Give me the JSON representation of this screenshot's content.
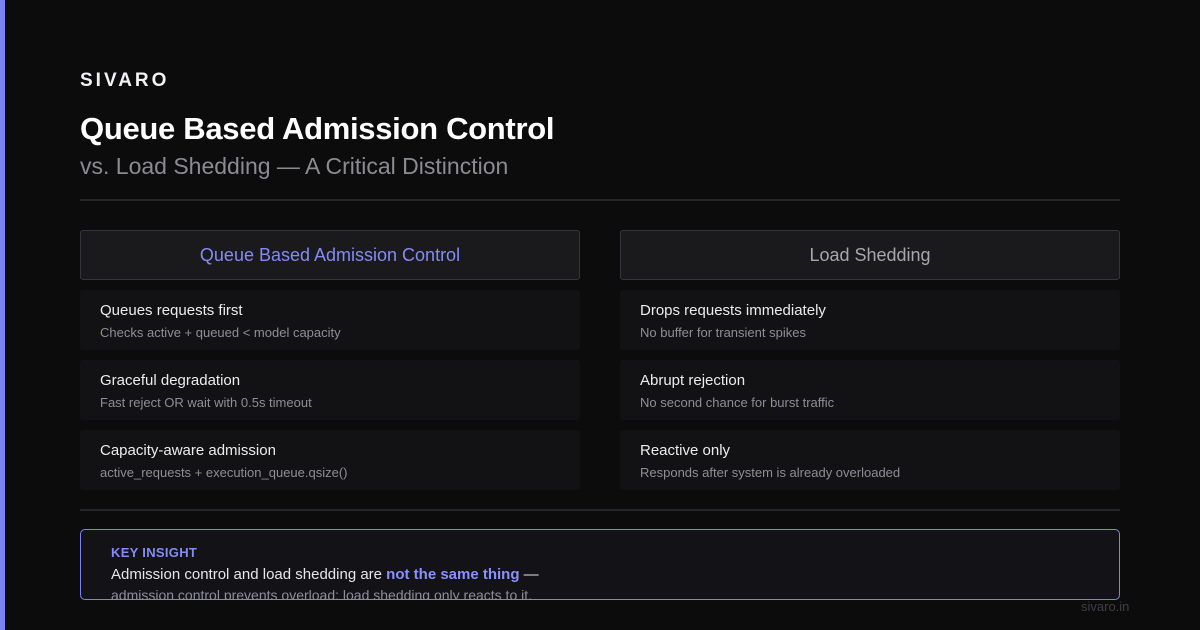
{
  "brand": "SIVARO",
  "title": "Queue Based Admission Control",
  "subtitle": "vs. Load Shedding — A Critical Distinction",
  "colors": {
    "accent": "#7c82f2",
    "background": "#0c0c0d",
    "highlight": "#8a90ff"
  },
  "left_column": {
    "header": "Queue Based Admission Control",
    "cards": [
      {
        "title": "Queues requests first",
        "desc": "Checks active + queued < model capacity"
      },
      {
        "title": "Graceful degradation",
        "desc": "Fast reject OR wait with 0.5s timeout"
      },
      {
        "title": "Capacity-aware admission",
        "desc": "active_requests + execution_queue.qsize()"
      }
    ]
  },
  "right_column": {
    "header": "Load Shedding",
    "cards": [
      {
        "title": "Drops requests immediately",
        "desc": "No buffer for transient spikes"
      },
      {
        "title": "Abrupt rejection",
        "desc": "No second chance for burst traffic"
      },
      {
        "title": "Reactive only",
        "desc": "Responds after system is already overloaded"
      }
    ]
  },
  "insight": {
    "label": "KEY INSIGHT",
    "line1_prefix": "Admission control and load shedding are ",
    "line1_highlight": "not the same thing",
    "line1_suffix": " —",
    "line2": "admission control prevents overload; load shedding only reacts to it."
  },
  "footer": {
    "url": "sivaro.in"
  }
}
